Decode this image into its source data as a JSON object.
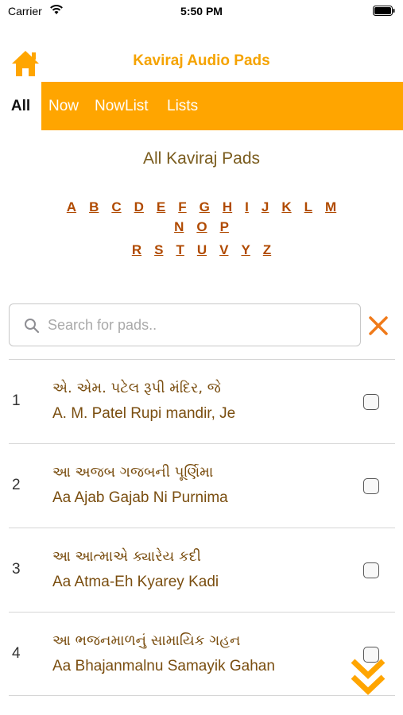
{
  "status_bar": {
    "carrier": "Carrier",
    "time": "5:50 PM"
  },
  "header": {
    "title": "Kaviraj Audio Pads",
    "home_icon": "home-icon"
  },
  "tabs": [
    {
      "label": "All",
      "active": true
    },
    {
      "label": "Now",
      "active": false
    },
    {
      "label": "NowList",
      "active": false
    },
    {
      "label": "Lists",
      "active": false
    }
  ],
  "section_title": "All Kaviraj Pads",
  "alphabet_rows": [
    [
      "A",
      "B",
      "C",
      "D",
      "E",
      "F",
      "G",
      "H",
      "I",
      "J",
      "K",
      "L",
      "M"
    ],
    [
      "N",
      "O",
      "P"
    ],
    [
      "R",
      "S",
      "T",
      "U",
      "V",
      "Y",
      "Z"
    ]
  ],
  "search": {
    "placeholder": "Search for pads..",
    "value": ""
  },
  "items": [
    {
      "num": "1",
      "gujarati": "એ. એમ. પટેલ રૂપી મંદિર, જે",
      "english": "A. M. Patel Rupi mandir, Je",
      "checked": false
    },
    {
      "num": "2",
      "gujarati": "આ અજબ ગજબની પૂર્ણિમા",
      "english": "Aa Ajab Gajab Ni Purnima",
      "checked": false
    },
    {
      "num": "3",
      "gujarati": "આ આત્માએ ક્યારેય કદી",
      "english": "Aa Atma-Eh Kyarey Kadi",
      "checked": false
    },
    {
      "num": "4",
      "gujarati": "આ ભજનમાળનું સામાયિક ગહન",
      "english": "Aa Bhajanmalnu Samayik Gahan",
      "checked": false
    }
  ],
  "colors": {
    "accent": "#ffa500",
    "title": "#f5a300",
    "text_brown": "#7a4e10",
    "link": "#b04a00",
    "clear": "#f07a1a"
  }
}
